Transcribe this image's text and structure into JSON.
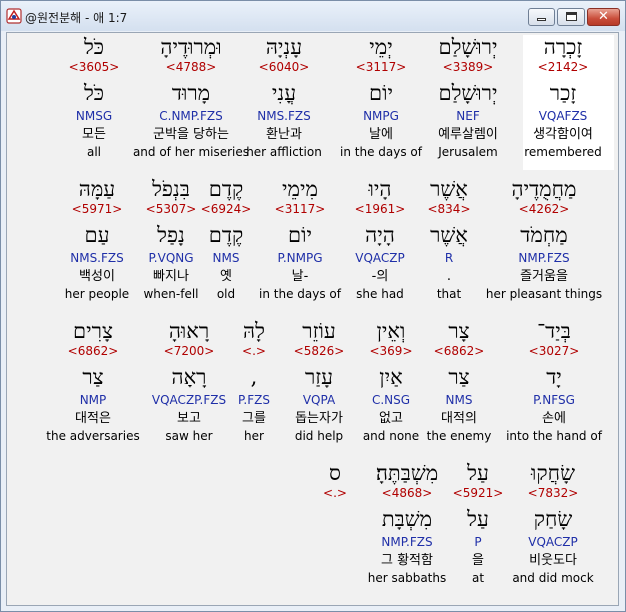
{
  "window": {
    "title": "@원전분해 - 애 1:7",
    "icons": {
      "app": "app-icon",
      "minimize": "minimize-icon",
      "maximize": "maximize-icon",
      "close": "close-icon"
    },
    "close_symbol": "✕"
  },
  "rows": [
    [
      {
        "word": "זָכְרָה",
        "strong": "<2142>",
        "lemma": "זָכַר",
        "morph": "VQAFZS",
        "kor": "생각함이여",
        "eng": "remembered"
      },
      {
        "word": "יְרוּשָׁלַם",
        "strong": "<3389>",
        "lemma": "יְרוּשָׁלַם",
        "morph": "NEF",
        "kor": "예루살렘이",
        "eng": "Jerusalem"
      },
      {
        "word": "יְמֵי",
        "strong": "<3117>",
        "lemma": "יוֹם",
        "morph": "NMPG",
        "kor": "날에",
        "eng": "in the days of"
      },
      {
        "word": "עָנְיָהּ",
        "strong": "<6040>",
        "lemma": "עֳנִי",
        "morph": "NMS.FZS",
        "kor": "환난과",
        "eng": "her affliction"
      },
      {
        "word": "וּמְרוּדֶיהָ",
        "strong": "<4788>",
        "lemma": "מָרוּד",
        "morph": "C.NMP.FZS",
        "kor": "군박을 당하는",
        "eng": "and of her miseries"
      },
      {
        "word": "כֹּל",
        "strong": "<3605>",
        "lemma": "כֹּל",
        "morph": "NMSG",
        "kor": "모든",
        "eng": "all"
      }
    ],
    [
      {
        "word": "מַחֲמֻדֶיהָ",
        "strong": "<4262>",
        "lemma": "מַחְמֹד",
        "morph": "NMP.FZS",
        "kor": "즐거움을",
        "eng": "her pleasant things"
      },
      {
        "word": "אֲשֶׁר",
        "strong": "<834>",
        "lemma": "אֲשֶׁר",
        "morph": "R",
        "kor": ".",
        "eng": "that"
      },
      {
        "word": "הָיוּ",
        "strong": "<1961>",
        "lemma": "הָיָה",
        "morph": "VQACZP",
        "kor": "-의",
        "eng": "she had"
      },
      {
        "word": "מִימֵי",
        "strong": "<3117>",
        "lemma": "יוֹם",
        "morph": "P.NMPG",
        "kor": "날-",
        "eng": "in the days of"
      },
      {
        "word": "קֶדֶם",
        "strong": "<6924>",
        "lemma": "קֶדֶם",
        "morph": "NMS",
        "kor": "옛",
        "eng": "old"
      },
      {
        "word": "בִּנְפֹל",
        "strong": "<5307>",
        "lemma": "נָפַל",
        "morph": "P.VQNG",
        "kor": "빠지나",
        "eng": "when-fell"
      },
      {
        "word": "עַמָּהּ",
        "strong": "<5971>",
        "lemma": "עַם",
        "morph": "NMS.FZS",
        "kor": "백성이",
        "eng": "her people"
      }
    ],
    [
      {
        "word": "בְּיַד־",
        "strong": "<3027>",
        "lemma": "יָד",
        "morph": "P.NFSG",
        "kor": "손에",
        "eng": "into the hand of"
      },
      {
        "word": "צָר",
        "strong": "<6862>",
        "lemma": "צַר",
        "morph": "NMS",
        "kor": "대적의",
        "eng": "the enemy"
      },
      {
        "word": "וְאֵין",
        "strong": "<369>",
        "lemma": "אַיִן",
        "morph": "C.NSG",
        "kor": "없고",
        "eng": "and none"
      },
      {
        "word": "עוֹזֵר",
        "strong": "<5826>",
        "lemma": "עָזַר",
        "morph": "VQPA",
        "kor": "돕는자가",
        "eng": "did help"
      },
      {
        "word": "לָהּ",
        "strong": "<.>",
        "lemma": ",",
        "morph": "P.FZS",
        "kor": "그를",
        "eng": "her"
      },
      {
        "word": "רָאוּהָ",
        "strong": "<7200>",
        "lemma": "רָאָה",
        "morph": "VQACZP.FZS",
        "kor": "보고",
        "eng": "saw her"
      },
      {
        "word": "צָרִים",
        "strong": "<6862>",
        "lemma": "צַר",
        "morph": "NMP",
        "kor": "대적은",
        "eng": "the adversaries"
      }
    ],
    [
      {
        "word": "שָׂחֲקוּ",
        "strong": "<7832>",
        "lemma": "שָׂחַק",
        "morph": "VQACZP",
        "kor": "비웃도다",
        "eng": "and did mock"
      },
      {
        "word": "עַל",
        "strong": "<5921>",
        "lemma": "עַל",
        "morph": "P",
        "kor": "을",
        "eng": "at"
      },
      {
        "word": "מִשְׁבַּתֶּהָ׃",
        "strong": "<4868>",
        "lemma": "מִשְׁבָּת",
        "morph": "NMP.FZS",
        "kor": "그 황적함",
        "eng": "her sabbaths"
      },
      {
        "word": "ס",
        "strong": "<.>",
        "lemma": "",
        "morph": "",
        "kor": "",
        "eng": ""
      }
    ]
  ]
}
